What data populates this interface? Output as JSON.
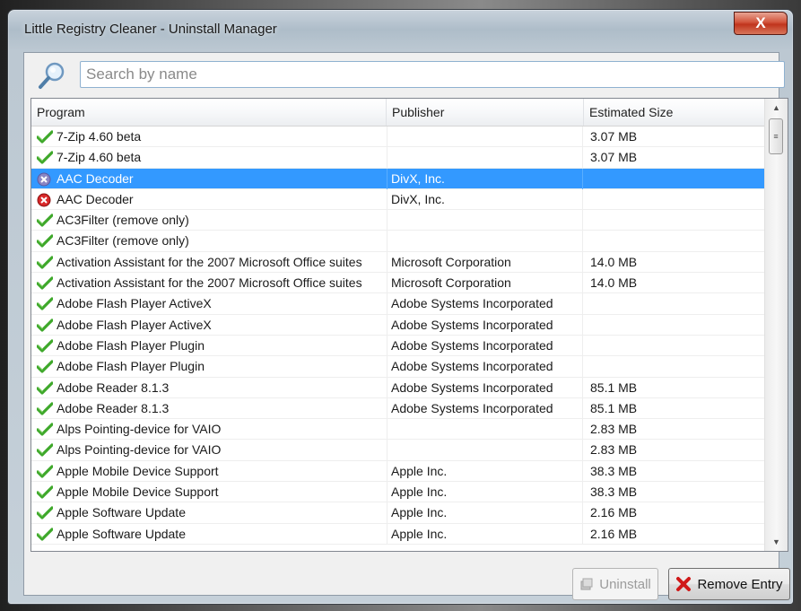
{
  "window": {
    "title": "Little Registry Cleaner - Uninstall Manager",
    "close_glyph": "X"
  },
  "search": {
    "placeholder": "Search by name",
    "value": ""
  },
  "list": {
    "columns": [
      "Program",
      "Publisher",
      "Estimated Size"
    ],
    "rows": [
      {
        "program": "7-Zip 4.60 beta",
        "publisher": "",
        "size": "3.07 MB",
        "status": "ok",
        "selected": false
      },
      {
        "program": "7-Zip 4.60 beta",
        "publisher": "",
        "size": "3.07 MB",
        "status": "ok",
        "selected": false
      },
      {
        "program": "AAC Decoder",
        "publisher": "DivX, Inc.",
        "size": "",
        "status": "error",
        "selected": true
      },
      {
        "program": "AAC Decoder",
        "publisher": "DivX, Inc.",
        "size": "",
        "status": "error",
        "selected": false
      },
      {
        "program": "AC3Filter (remove only)",
        "publisher": "",
        "size": "",
        "status": "ok",
        "selected": false
      },
      {
        "program": "AC3Filter (remove only)",
        "publisher": "",
        "size": "",
        "status": "ok",
        "selected": false
      },
      {
        "program": "Activation Assistant for the 2007 Microsoft Office suites",
        "publisher": "Microsoft Corporation",
        "size": "14.0 MB",
        "status": "ok",
        "selected": false
      },
      {
        "program": "Activation Assistant for the 2007 Microsoft Office suites",
        "publisher": "Microsoft Corporation",
        "size": "14.0 MB",
        "status": "ok",
        "selected": false
      },
      {
        "program": "Adobe Flash Player ActiveX",
        "publisher": "Adobe Systems Incorporated",
        "size": "",
        "status": "ok",
        "selected": false
      },
      {
        "program": "Adobe Flash Player ActiveX",
        "publisher": "Adobe Systems Incorporated",
        "size": "",
        "status": "ok",
        "selected": false
      },
      {
        "program": "Adobe Flash Player Plugin",
        "publisher": "Adobe Systems Incorporated",
        "size": "",
        "status": "ok",
        "selected": false
      },
      {
        "program": "Adobe Flash Player Plugin",
        "publisher": "Adobe Systems Incorporated",
        "size": "",
        "status": "ok",
        "selected": false
      },
      {
        "program": "Adobe Reader 8.1.3",
        "publisher": "Adobe Systems Incorporated",
        "size": "85.1 MB",
        "status": "ok",
        "selected": false
      },
      {
        "program": "Adobe Reader 8.1.3",
        "publisher": "Adobe Systems Incorporated",
        "size": "85.1 MB",
        "status": "ok",
        "selected": false
      },
      {
        "program": "Alps Pointing-device for VAIO",
        "publisher": "",
        "size": "2.83 MB",
        "status": "ok",
        "selected": false
      },
      {
        "program": "Alps Pointing-device for VAIO",
        "publisher": "",
        "size": "2.83 MB",
        "status": "ok",
        "selected": false
      },
      {
        "program": "Apple Mobile Device Support",
        "publisher": "Apple Inc.",
        "size": "38.3 MB",
        "status": "ok",
        "selected": false
      },
      {
        "program": "Apple Mobile Device Support",
        "publisher": "Apple Inc.",
        "size": "38.3 MB",
        "status": "ok",
        "selected": false
      },
      {
        "program": "Apple Software Update",
        "publisher": "Apple Inc.",
        "size": "2.16 MB",
        "status": "ok",
        "selected": false
      },
      {
        "program": "Apple Software Update",
        "publisher": "Apple Inc.",
        "size": "2.16 MB",
        "status": "ok",
        "selected": false
      }
    ]
  },
  "buttons": {
    "uninstall_label": "Uninstall",
    "remove_label": "Remove Entry"
  },
  "colors": {
    "selection": "#3399ff",
    "ok_icon": "#3ea82a",
    "error_icon": "#d8282a"
  }
}
